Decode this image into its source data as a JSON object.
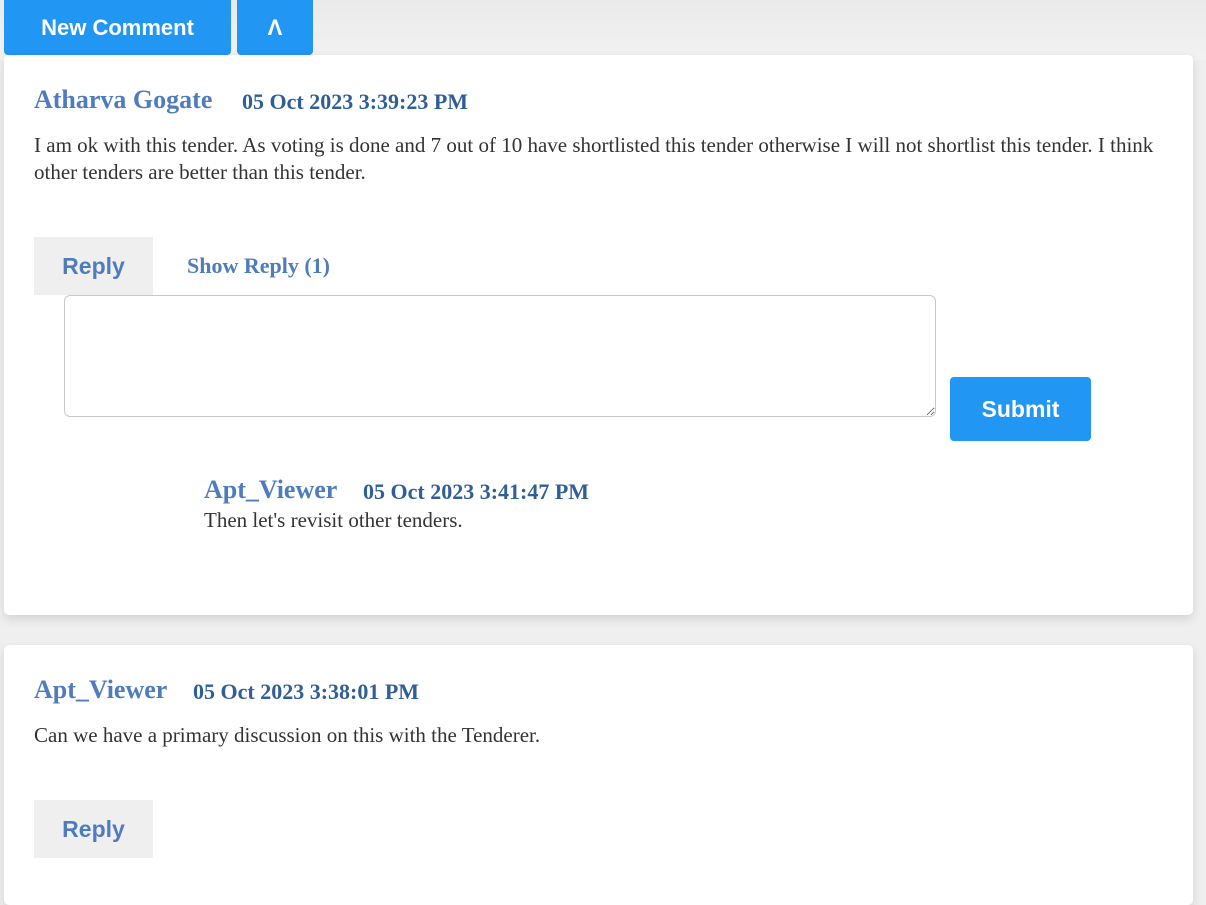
{
  "toolbar": {
    "new_comment_label": "New Comment",
    "collapse_label": "Λ"
  },
  "comments": [
    {
      "author": "Atharva Gogate",
      "timestamp": "05 Oct 2023 3:39:23 PM",
      "text": "I am ok with this tender. As voting is done and 7 out of 10 have shortlisted this tender otherwise I will not shortlist this tender. I think other tenders are better than this tender.",
      "reply_label": "Reply",
      "show_reply_label": "Show Reply (1)",
      "reply_input": {
        "value": "",
        "placeholder": ""
      },
      "submit_label": "Submit",
      "replies": [
        {
          "author": "Apt_Viewer",
          "timestamp": "05 Oct 2023 3:41:47 PM",
          "text": "Then let's revisit other tenders."
        }
      ]
    },
    {
      "author": "Apt_Viewer",
      "timestamp": "05 Oct 2023 3:38:01 PM",
      "text": "Can we have a primary discussion on this with the Tenderer.",
      "reply_label": "Reply"
    }
  ],
  "colors": {
    "accent": "#2196f3",
    "author": "#4f7cbf",
    "timestamp": "#2f5f96"
  }
}
